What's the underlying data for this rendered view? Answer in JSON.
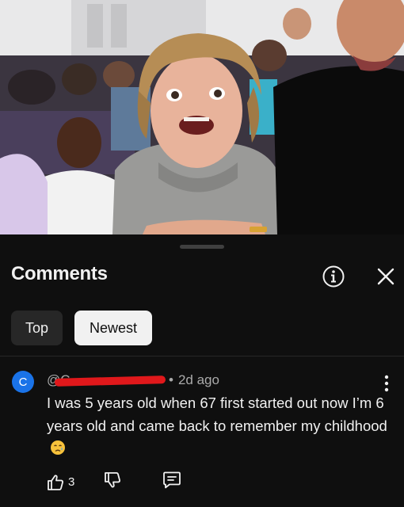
{
  "sheet": {
    "title": "Comments",
    "icons": {
      "info": "info-icon",
      "close": "close-icon"
    }
  },
  "sort_chips": [
    {
      "label": "Top",
      "selected": false
    },
    {
      "label": "Newest",
      "selected": true
    }
  ],
  "comment": {
    "avatar_letter": "C",
    "avatar_color": "#1a73e8",
    "handle": "@C",
    "handle_redacted": true,
    "redaction_color": "#e0181b",
    "time": "2d ago",
    "text": "I was 5 years old when 67 first started out now I’m 6 years old and came back to remember my childhood",
    "emoji": "crying-face-emoji",
    "like_count": "3",
    "icons": {
      "like": "thumbs-up-icon",
      "dislike": "thumbs-down-icon",
      "reply": "reply-icon",
      "more": "more-vertical-icon"
    }
  },
  "colors": {
    "background": "#0f0f0f",
    "chip_inactive": "#272727",
    "chip_active": "#f1f1f1",
    "secondary_text": "#aaaaaa"
  }
}
